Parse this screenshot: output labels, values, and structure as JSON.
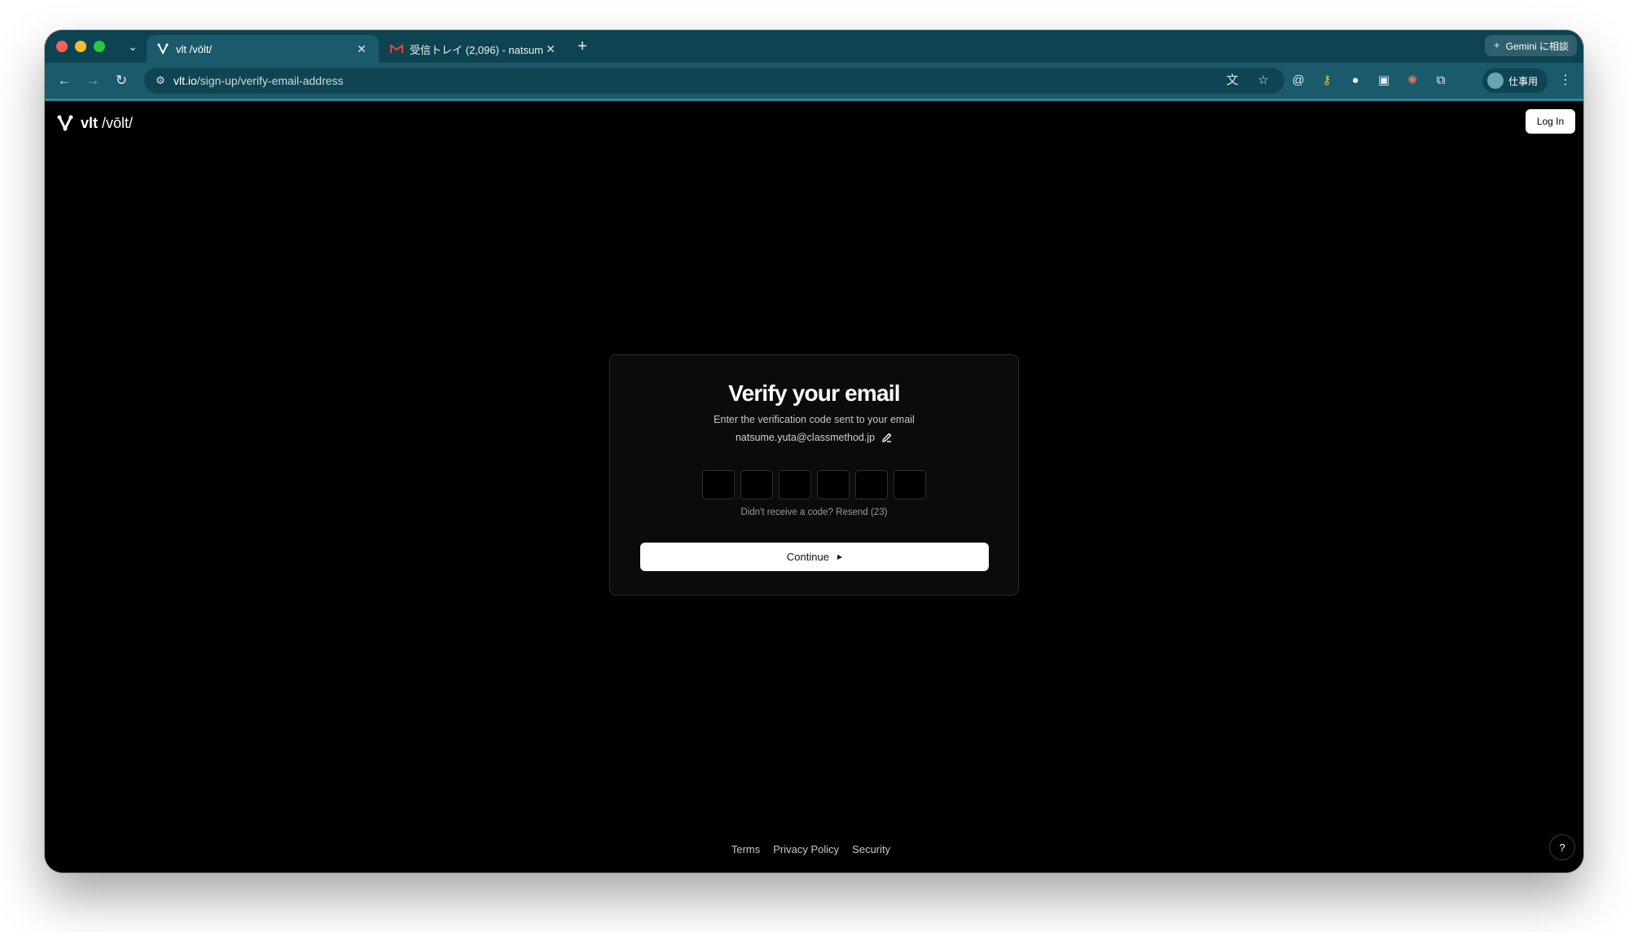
{
  "browser": {
    "tabs": [
      {
        "title": "vlt /vōlt/",
        "active": true,
        "icon": "vlt-logo-icon"
      },
      {
        "title": "受信トレイ (2,096) - natsume",
        "active": false,
        "icon": "gmail-icon"
      }
    ],
    "new_tab_label": "+",
    "gemini_label": "Gemini に相談",
    "url_host": "vlt.io",
    "url_path": "/sign-up/verify-email-address",
    "profile_label": "仕事用"
  },
  "page": {
    "logo_name": "vlt",
    "logo_pron": "/vōlt/",
    "login_label": "Log In",
    "card": {
      "title": "Verify your email",
      "subtitle": "Enter the verification code sent to your email",
      "email": "natsume.yuta@classmethod.jp",
      "otp_digits": [
        "",
        "",
        "",
        "",
        "",
        ""
      ],
      "resend_text": "Didn't receive a code? Resend (23)",
      "continue_label": "Continue"
    },
    "footer_links": [
      "Terms",
      "Privacy Policy",
      "Security"
    ],
    "help_label": "?"
  },
  "colors": {
    "tabstrip": "#0e4452",
    "toolbar": "#1b5a6a",
    "page_bg": "#000000",
    "card_bg": "#0b0b0b"
  }
}
